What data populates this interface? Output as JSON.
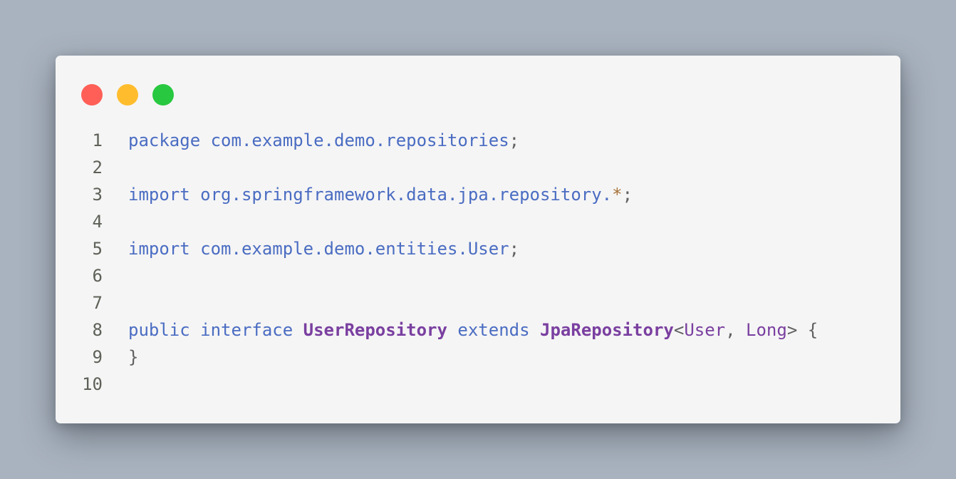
{
  "window": {
    "controls": [
      {
        "name": "close",
        "color": "#ff5f57"
      },
      {
        "name": "minimize",
        "color": "#ffbd2e"
      },
      {
        "name": "maximize",
        "color": "#28c840"
      }
    ]
  },
  "code": {
    "lines": [
      {
        "n": "1",
        "tokens": [
          {
            "t": "package",
            "c": "kw"
          },
          {
            "t": " ",
            "c": "punc"
          },
          {
            "t": "com.example.demo.repositories",
            "c": "pkg"
          },
          {
            "t": ";",
            "c": "punc"
          }
        ]
      },
      {
        "n": "2",
        "tokens": []
      },
      {
        "n": "3",
        "tokens": [
          {
            "t": "import",
            "c": "kw"
          },
          {
            "t": " ",
            "c": "punc"
          },
          {
            "t": "org.springframework.data.jpa.repository.",
            "c": "pkg"
          },
          {
            "t": "*",
            "c": "star"
          },
          {
            "t": ";",
            "c": "punc"
          }
        ]
      },
      {
        "n": "4",
        "tokens": []
      },
      {
        "n": "5",
        "tokens": [
          {
            "t": "import",
            "c": "kw"
          },
          {
            "t": " ",
            "c": "punc"
          },
          {
            "t": "com.example.demo.entities.User",
            "c": "pkg"
          },
          {
            "t": ";",
            "c": "punc"
          }
        ]
      },
      {
        "n": "6",
        "tokens": []
      },
      {
        "n": "7",
        "tokens": []
      },
      {
        "n": "8",
        "tokens": [
          {
            "t": "public",
            "c": "kw"
          },
          {
            "t": " ",
            "c": "punc"
          },
          {
            "t": "interface",
            "c": "kw"
          },
          {
            "t": " ",
            "c": "punc"
          },
          {
            "t": "UserRepository",
            "c": "type-b"
          },
          {
            "t": " ",
            "c": "punc"
          },
          {
            "t": "extends",
            "c": "kw"
          },
          {
            "t": " ",
            "c": "punc"
          },
          {
            "t": "JpaRepository",
            "c": "type-b"
          },
          {
            "t": "<",
            "c": "punc"
          },
          {
            "t": "User",
            "c": "type"
          },
          {
            "t": ", ",
            "c": "punc"
          },
          {
            "t": "Long",
            "c": "type"
          },
          {
            "t": "> ",
            "c": "punc"
          },
          {
            "t": "{",
            "c": "brace"
          }
        ]
      },
      {
        "n": "9",
        "tokens": [
          {
            "t": "}",
            "c": "brace"
          }
        ]
      },
      {
        "n": "10",
        "tokens": []
      }
    ]
  }
}
